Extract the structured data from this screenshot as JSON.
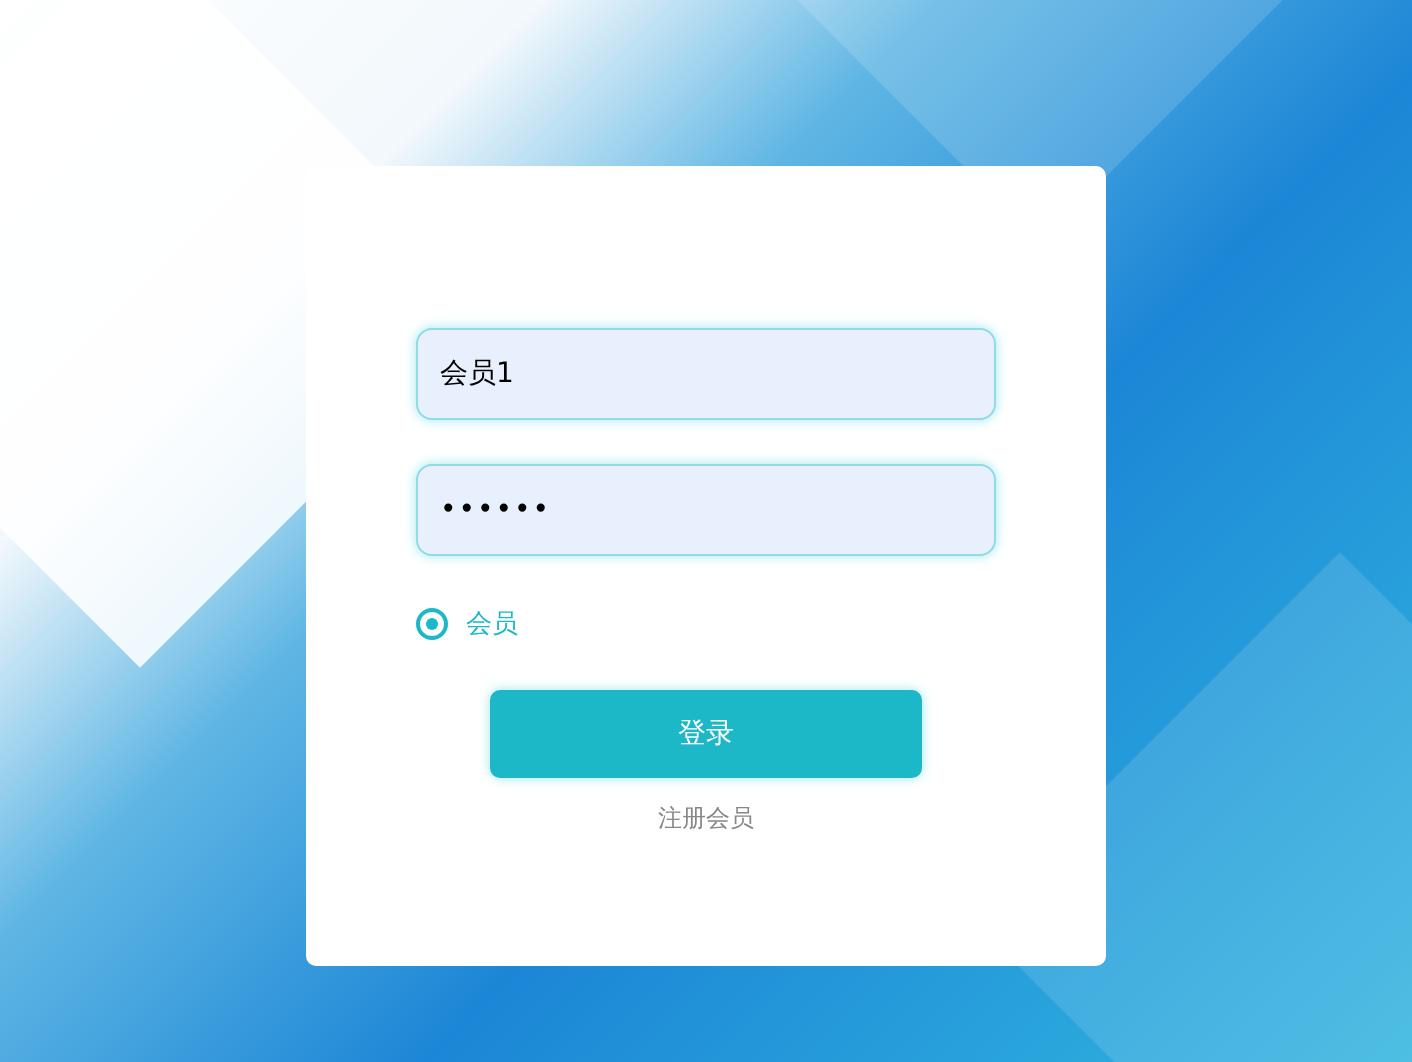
{
  "login_form": {
    "username": {
      "value": "会员1"
    },
    "password": {
      "value": "••••••"
    },
    "roles": [
      {
        "label": "会员",
        "selected": true
      }
    ],
    "login_button": "登录",
    "register_link": "注册会员"
  }
}
